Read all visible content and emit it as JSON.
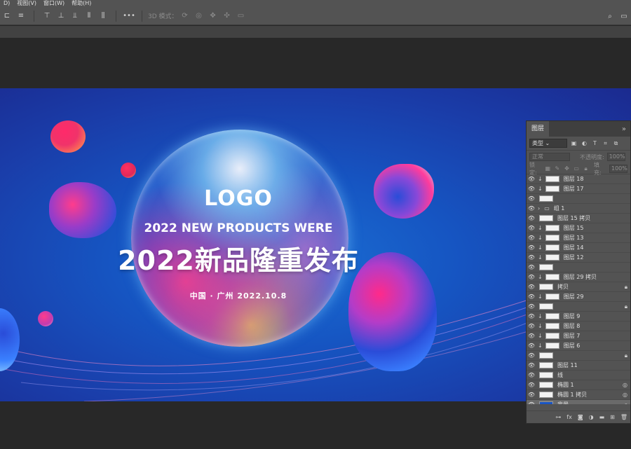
{
  "menu": [
    "D)",
    "视图(V)",
    "窗口(W)",
    "帮助(H)"
  ],
  "options_bar": {
    "mode_label": "3D 模式：",
    "more_label": "•••"
  },
  "poster": {
    "logo": "LOGO",
    "english": "2022 NEW PRODUCTS WERE",
    "chinese": "2022新品隆重发布",
    "date": "中国 · 广州   2022.10.8",
    "bg_color": "#1a55c2"
  },
  "layers_panel": {
    "tab": "图层",
    "filter_kind": "类型",
    "blend_mode": "正常",
    "opacity_label": "不透明度:",
    "opacity_value": "100%",
    "lock_label": "锁定:",
    "fill_label": "填充:",
    "fill_value": "100%",
    "layers": [
      {
        "name": "图层 18",
        "clip": true,
        "badge": ""
      },
      {
        "name": "图层 17",
        "clip": true,
        "badge": ""
      },
      {
        "name": "",
        "clip": false,
        "badge": ""
      },
      {
        "name": "组 1",
        "clip": false,
        "badge": "",
        "group": true
      },
      {
        "name": "图层 15 拷贝",
        "clip": false,
        "badge": ""
      },
      {
        "name": "图层 15",
        "clip": true,
        "badge": ""
      },
      {
        "name": "图层 13",
        "clip": true,
        "badge": ""
      },
      {
        "name": "图层 14",
        "clip": true,
        "badge": ""
      },
      {
        "name": "图层 12",
        "clip": true,
        "badge": ""
      },
      {
        "name": "",
        "clip": false,
        "badge": ""
      },
      {
        "name": "图层 29 拷贝",
        "clip": true,
        "badge": ""
      },
      {
        "name": "拷贝",
        "clip": false,
        "badge": "lock"
      },
      {
        "name": "图层 29",
        "clip": true,
        "badge": ""
      },
      {
        "name": "",
        "clip": false,
        "badge": "lock"
      },
      {
        "name": "图层 9",
        "clip": true,
        "badge": ""
      },
      {
        "name": "图层 8",
        "clip": true,
        "badge": ""
      },
      {
        "name": "图层 7",
        "clip": true,
        "badge": ""
      },
      {
        "name": "图层 6",
        "clip": true,
        "badge": ""
      },
      {
        "name": "",
        "clip": false,
        "badge": "lock"
      },
      {
        "name": "图层 11",
        "clip": false,
        "badge": ""
      },
      {
        "name": "线",
        "clip": false,
        "badge": ""
      },
      {
        "name": "椭圆 1",
        "clip": false,
        "badge": "fx"
      },
      {
        "name": "椭圆 1 拷贝",
        "clip": false,
        "badge": "fx"
      },
      {
        "name": "背景",
        "clip": false,
        "badge": "lock",
        "selected": true
      }
    ]
  }
}
